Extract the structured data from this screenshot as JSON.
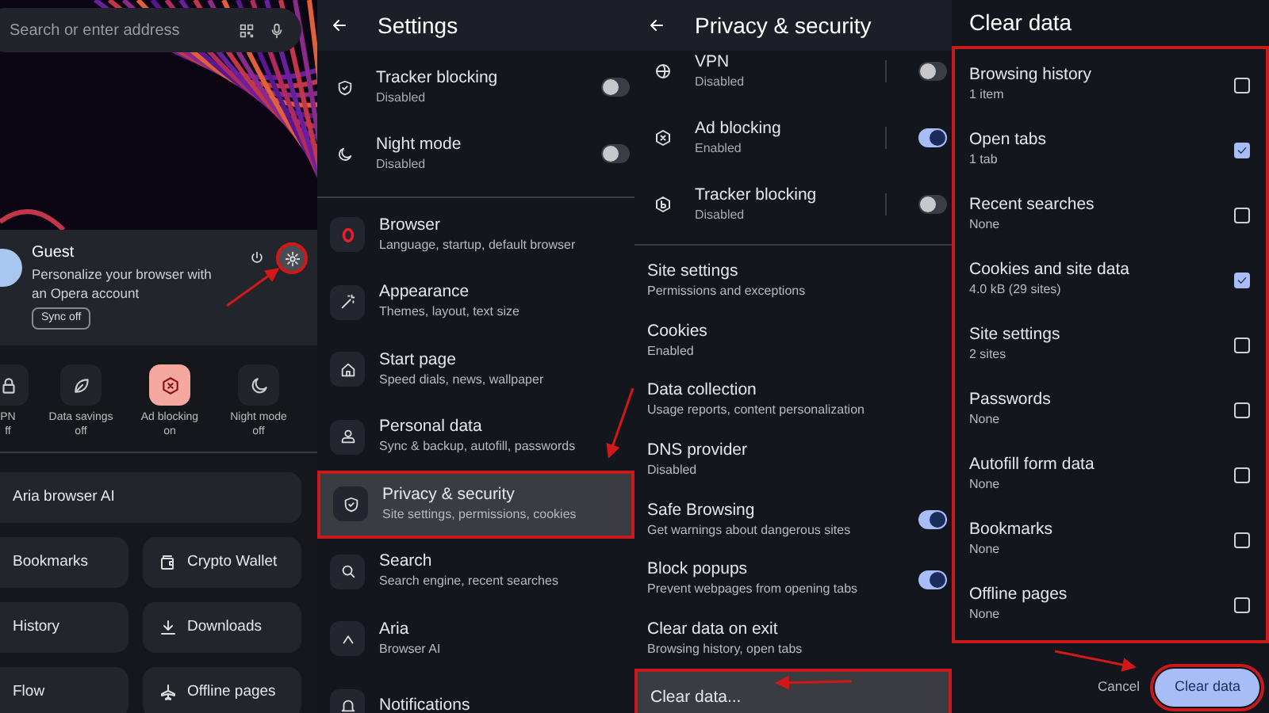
{
  "start_page": {
    "search": {
      "placeholder": "Search or enter address"
    },
    "profile": {
      "name": "Guest",
      "description": "Personalize your browser with an Opera account",
      "sync_button": "Sync off"
    },
    "quick_toggles": [
      {
        "label": "PN",
        "state": "ff",
        "on": false
      },
      {
        "label": "Data savings",
        "state": "off",
        "on": false
      },
      {
        "label": "Ad blocking",
        "state": "on",
        "on": true
      },
      {
        "label": "Night mode",
        "state": "off",
        "on": false
      }
    ],
    "tiles": [
      {
        "label": "Aria browser AI",
        "kind": "wide"
      },
      {
        "label": "Bookmarks",
        "kind": "half"
      },
      {
        "label": "Crypto Wallet",
        "kind": "half"
      },
      {
        "label": "History",
        "kind": "half"
      },
      {
        "label": "Downloads",
        "kind": "half"
      },
      {
        "label": "Flow",
        "kind": "half"
      },
      {
        "label": "Offline pages",
        "kind": "half"
      }
    ]
  },
  "settings": {
    "title": "Settings",
    "toggles": [
      {
        "title": "Tracker blocking",
        "subtitle": "Disabled",
        "on": false
      },
      {
        "title": "Night mode",
        "subtitle": "Disabled",
        "on": false
      }
    ],
    "items": [
      {
        "title": "Browser",
        "subtitle": "Language, startup, default browser",
        "selected": false
      },
      {
        "title": "Appearance",
        "subtitle": "Themes, layout, text size",
        "selected": false
      },
      {
        "title": "Start page",
        "subtitle": "Speed dials, news, wallpaper",
        "selected": false
      },
      {
        "title": "Personal data",
        "subtitle": "Sync & backup, autofill, passwords",
        "selected": false
      },
      {
        "title": "Privacy & security",
        "subtitle": "Site settings, permissions, cookies",
        "selected": true
      },
      {
        "title": "Search",
        "subtitle": "Search engine, recent searches",
        "selected": false
      },
      {
        "title": "Aria",
        "subtitle": "Browser AI",
        "selected": false
      },
      {
        "title": "Notifications",
        "selected": false
      }
    ]
  },
  "privacy": {
    "title": "Privacy & security",
    "toggles": [
      {
        "title": "VPN",
        "subtitle": "Disabled",
        "on": false
      },
      {
        "title": "Ad blocking",
        "subtitle": "Enabled",
        "on": true
      },
      {
        "title": "Tracker blocking",
        "subtitle": "Disabled",
        "on": false
      }
    ],
    "items": [
      {
        "title": "Site settings",
        "subtitle": "Permissions and exceptions",
        "kind": "link",
        "selected": false
      },
      {
        "title": "Cookies",
        "subtitle": "Enabled",
        "kind": "link",
        "selected": false
      },
      {
        "title": "Data collection",
        "subtitle": "Usage reports, content personalization",
        "kind": "link",
        "selected": false
      },
      {
        "title": "DNS provider",
        "subtitle": "Disabled",
        "kind": "link",
        "selected": false
      },
      {
        "title": "Safe Browsing",
        "subtitle": "Get warnings about dangerous sites",
        "kind": "toggle",
        "on": true,
        "selected": false
      },
      {
        "title": "Block popups",
        "subtitle": "Prevent webpages from opening tabs",
        "kind": "toggle",
        "on": true,
        "selected": false
      },
      {
        "title": "Clear data on exit",
        "subtitle": "Browsing history, open tabs",
        "kind": "link",
        "selected": false
      },
      {
        "title": "Clear data...",
        "kind": "link",
        "selected": true
      }
    ]
  },
  "clear_data": {
    "title": "Clear data",
    "items": [
      {
        "title": "Browsing history",
        "subtitle": "1 item",
        "checked": false
      },
      {
        "title": "Open tabs",
        "subtitle": "1 tab",
        "checked": true
      },
      {
        "title": "Recent searches",
        "subtitle": "None",
        "checked": false
      },
      {
        "title": "Cookies and site data",
        "subtitle": "4.0 kB (29 sites)",
        "checked": true
      },
      {
        "title": "Site settings",
        "subtitle": "2 sites",
        "checked": false
      },
      {
        "title": "Passwords",
        "subtitle": "None",
        "checked": false
      },
      {
        "title": "Autofill form data",
        "subtitle": "None",
        "checked": false
      },
      {
        "title": "Bookmarks",
        "subtitle": "None",
        "checked": false
      },
      {
        "title": "Offline pages",
        "subtitle": "None",
        "checked": false
      }
    ],
    "cancel_button": "Cancel",
    "confirm_button": "Clear data"
  }
}
